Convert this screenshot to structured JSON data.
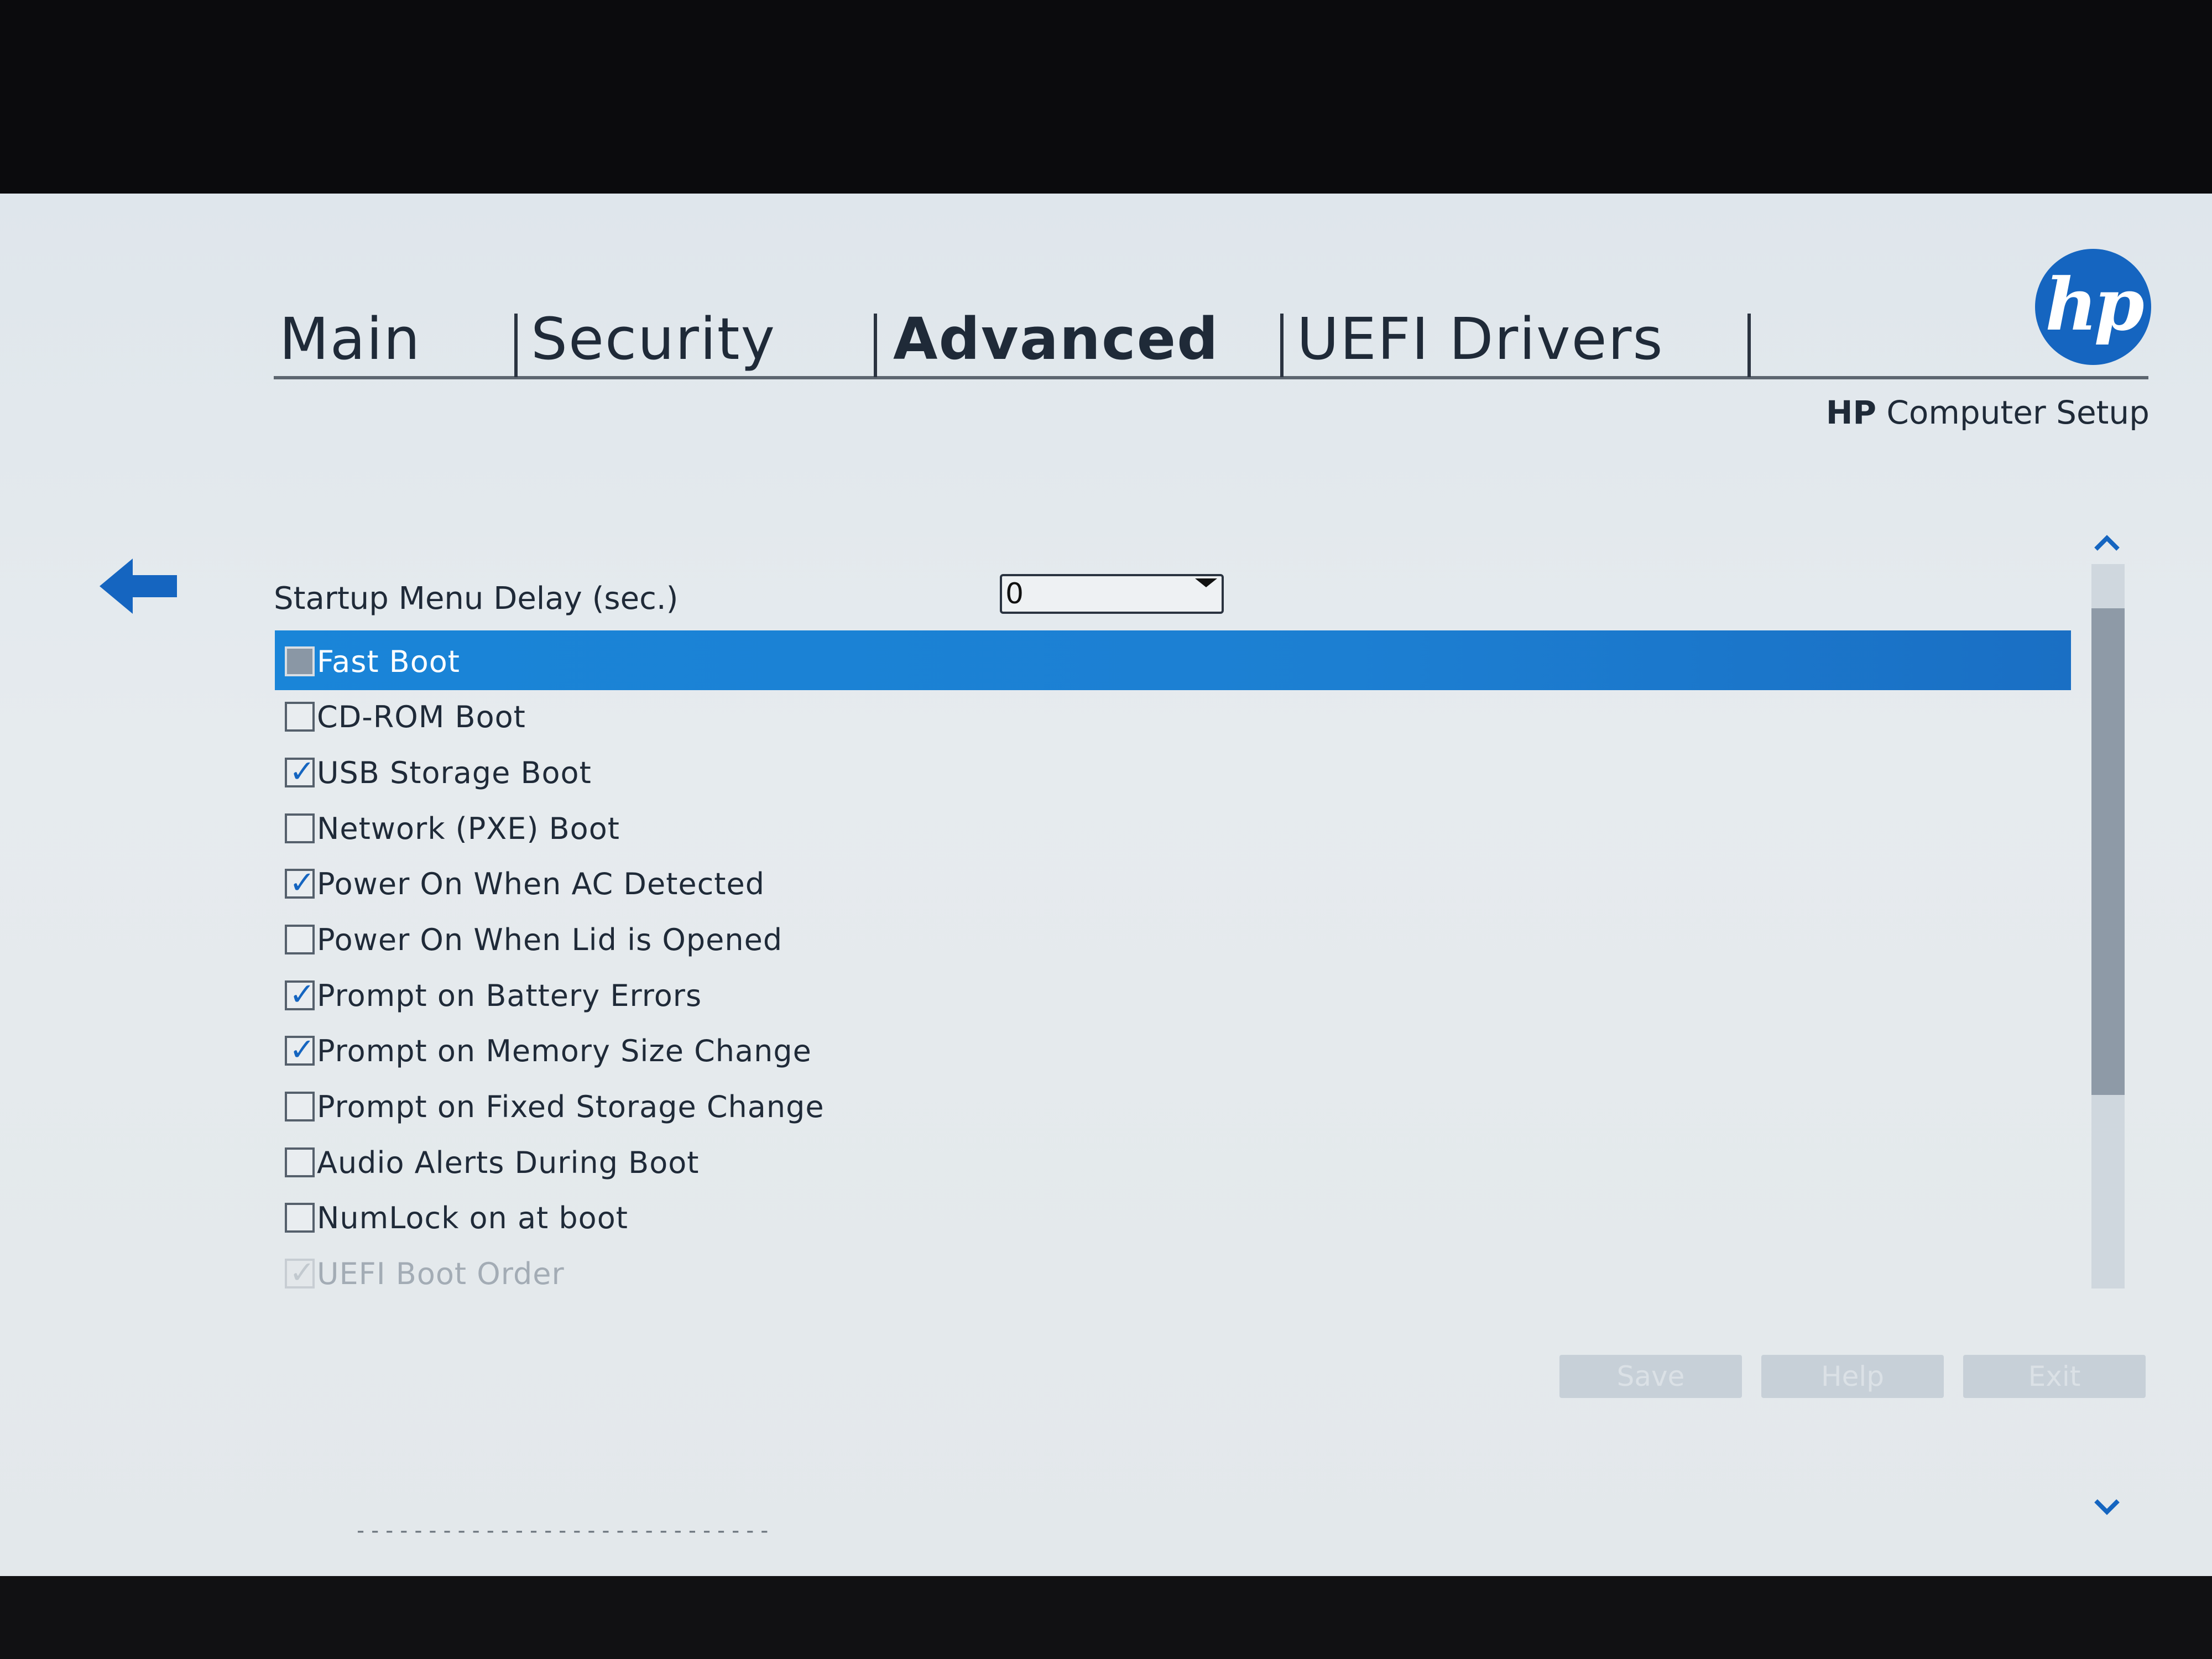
{
  "tabs": [
    {
      "label": "Main"
    },
    {
      "label": "Security"
    },
    {
      "label": "Advanced"
    },
    {
      "label": "UEFI Drivers"
    }
  ],
  "active_tab": "Advanced",
  "brand": {
    "logo_text": "hp",
    "subtitle_brand": "HP",
    "subtitle_rest": "Computer Setup",
    "logo_color": "#1565c0"
  },
  "startup_delay": {
    "label": "Startup Menu Delay (sec.)",
    "value": "0"
  },
  "options": [
    {
      "label": "Fast Boot",
      "checked": false,
      "selected": true,
      "disabled": false
    },
    {
      "label": "CD-ROM Boot",
      "checked": false,
      "selected": false,
      "disabled": false
    },
    {
      "label": "USB Storage Boot",
      "checked": true,
      "selected": false,
      "disabled": false
    },
    {
      "label": "Network (PXE) Boot",
      "checked": false,
      "selected": false,
      "disabled": false
    },
    {
      "label": "Power On When AC Detected",
      "checked": true,
      "selected": false,
      "disabled": false
    },
    {
      "label": "Power On When Lid is Opened",
      "checked": false,
      "selected": false,
      "disabled": false
    },
    {
      "label": "Prompt on Battery Errors",
      "checked": true,
      "selected": false,
      "disabled": false
    },
    {
      "label": "Prompt on Memory Size Change",
      "checked": true,
      "selected": false,
      "disabled": false
    },
    {
      "label": "Prompt on Fixed Storage Change",
      "checked": false,
      "selected": false,
      "disabled": false
    },
    {
      "label": "Audio Alerts During Boot",
      "checked": false,
      "selected": false,
      "disabled": false
    },
    {
      "label": "NumLock on at boot",
      "checked": false,
      "selected": false,
      "disabled": false
    },
    {
      "label": "UEFI Boot Order",
      "checked": true,
      "selected": false,
      "disabled": true
    }
  ],
  "separator": "-----------------------------",
  "buttons": {
    "save": "Save",
    "help": "Help",
    "exit": "Exit"
  },
  "colors": {
    "highlight": "#1a85d8",
    "accent": "#1565c0"
  },
  "icons": {
    "back": "back-arrow-icon",
    "scroll_up": "chevron-up-icon",
    "scroll_down": "chevron-down-icon",
    "check": "checkmark-icon"
  }
}
